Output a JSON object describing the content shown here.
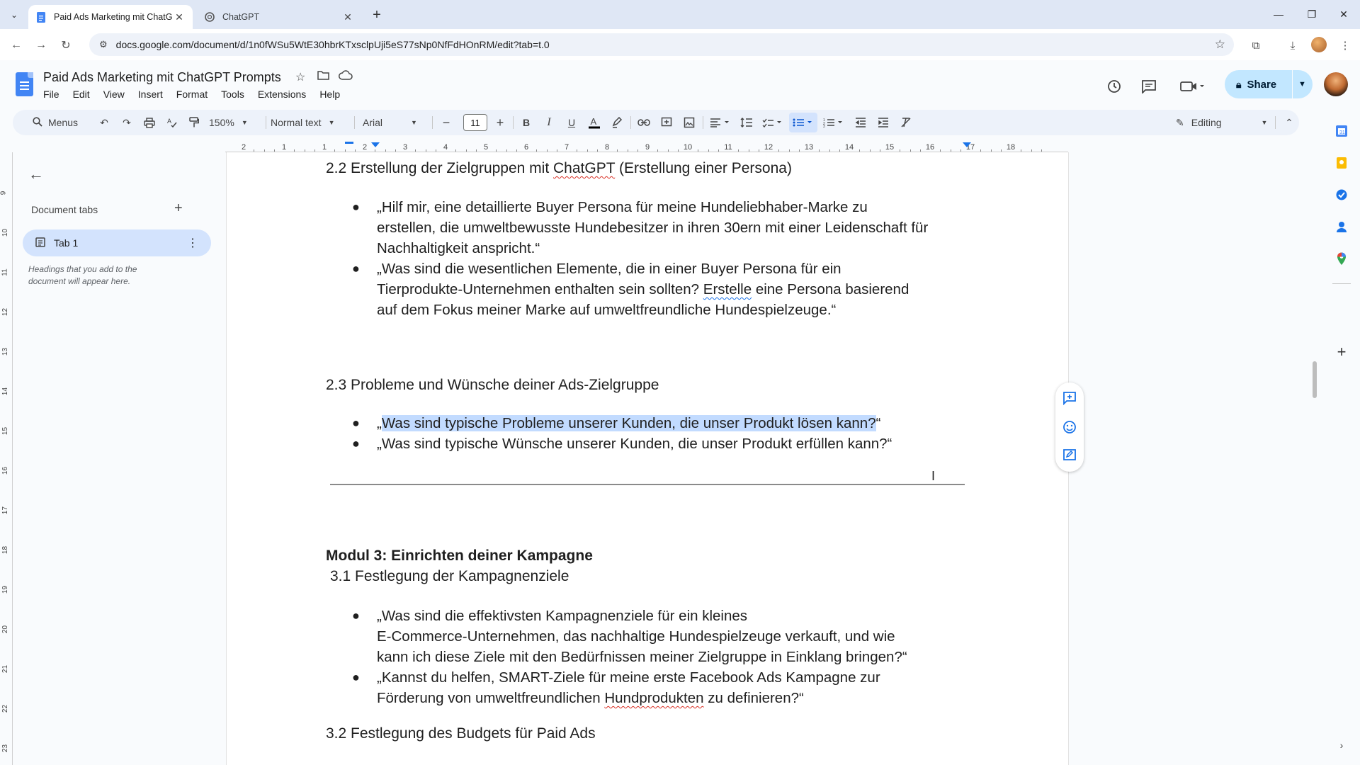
{
  "browser": {
    "tabs": [
      {
        "title": "Paid Ads Marketing mit ChatGPT",
        "active": true
      },
      {
        "title": "ChatGPT",
        "active": false
      }
    ],
    "url": "docs.google.com/document/d/1n0fWSu5WtE30hbrKTxsclpUji5eS77sNp0NfFdHOnRM/edit?tab=t.0"
  },
  "doc": {
    "title": "Paid Ads Marketing mit ChatGPT Prompts",
    "menus": [
      "File",
      "Edit",
      "View",
      "Insert",
      "Format",
      "Tools",
      "Extensions",
      "Help"
    ],
    "share_label": "Share"
  },
  "toolbar": {
    "search_label": "Menus",
    "zoom": "150%",
    "style": "Normal text",
    "font": "Arial",
    "font_size": "11",
    "mode": "Editing"
  },
  "ruler": {
    "numbers": [
      "2",
      "1",
      "1",
      "2",
      "3",
      "4",
      "5",
      "6",
      "7",
      "8",
      "9",
      "10",
      "11",
      "12",
      "13",
      "14",
      "15",
      "16",
      "17",
      "18"
    ],
    "vertical": [
      "9",
      "10",
      "11",
      "12",
      "13",
      "14",
      "15",
      "16",
      "17",
      "18",
      "19",
      "20",
      "21",
      "22",
      "23"
    ]
  },
  "sidebar": {
    "title": "Document tabs",
    "tab_label": "Tab 1",
    "hint": "Headings that you add to the document will appear here."
  },
  "content": {
    "h22_pre": "2.2 Erstellung der Zielgruppen mit ",
    "h22_spell": "ChatGPT",
    "h22_post": " (Erstellung einer Persona)",
    "b1_l1": "„Hilf mir, eine detaillierte Buyer Persona für meine Hundeliebhaber-Marke zu",
    "b1_l2": "erstellen, die umweltbewusste Hundebesitzer in ihren 30ern mit einer Leidenschaft für",
    "b1_l3": "Nachhaltigkeit anspricht.“",
    "b2_l1": "„Was sind die wesentlichen Elemente, die in einer Buyer Persona für ein",
    "b2_l2_pre": "Tierprodukte-Unternehmen enthalten sein sollten? ",
    "b2_l2_gram": "Erstelle",
    "b2_l2_post": " eine Persona basierend",
    "b2_l3": "auf dem Fokus meiner Marke auf umweltfreundliche Hundespielzeuge.“",
    "h23": "2.3 Probleme und Wünsche deiner Ads-Zielgruppe",
    "b3_open": "„",
    "b3_sel": "Was sind typische Probleme unserer Kunden, die unser Produkt lösen kann?",
    "b3_close": "“",
    "b4": "„Was sind typische Wünsche unserer Kunden, die unser Produkt erfüllen kann?“",
    "mod3": "Modul 3: Einrichten deiner Kampagne",
    "h31": "3.1 Festlegung der Kampagnenziele",
    "b5_l1": "„Was sind die effektivsten Kampagnenziele für ein kleines",
    "b5_l2": "E-Commerce-Unternehmen, das nachhaltige Hundespielzeuge verkauft, und wie",
    "b5_l3": "kann ich diese Ziele mit den Bedürfnissen meiner Zielgruppe in Einklang bringen?“",
    "b6_l1": "„Kannst du helfen, SMART-Ziele für meine erste Facebook Ads Kampagne zur",
    "b6_l2_pre": "Förderung von umweltfreundlichen ",
    "b6_l2_spell": "Hundprodukten",
    "b6_l2_post": " zu definieren?“",
    "h32": "3.2 Festlegung des Budgets für Paid Ads"
  },
  "icons": {
    "bullet": "●"
  },
  "colors": {
    "selection": "#c2dbff",
    "share_bg": "#c2e7ff",
    "accent": "#1a73e8"
  }
}
